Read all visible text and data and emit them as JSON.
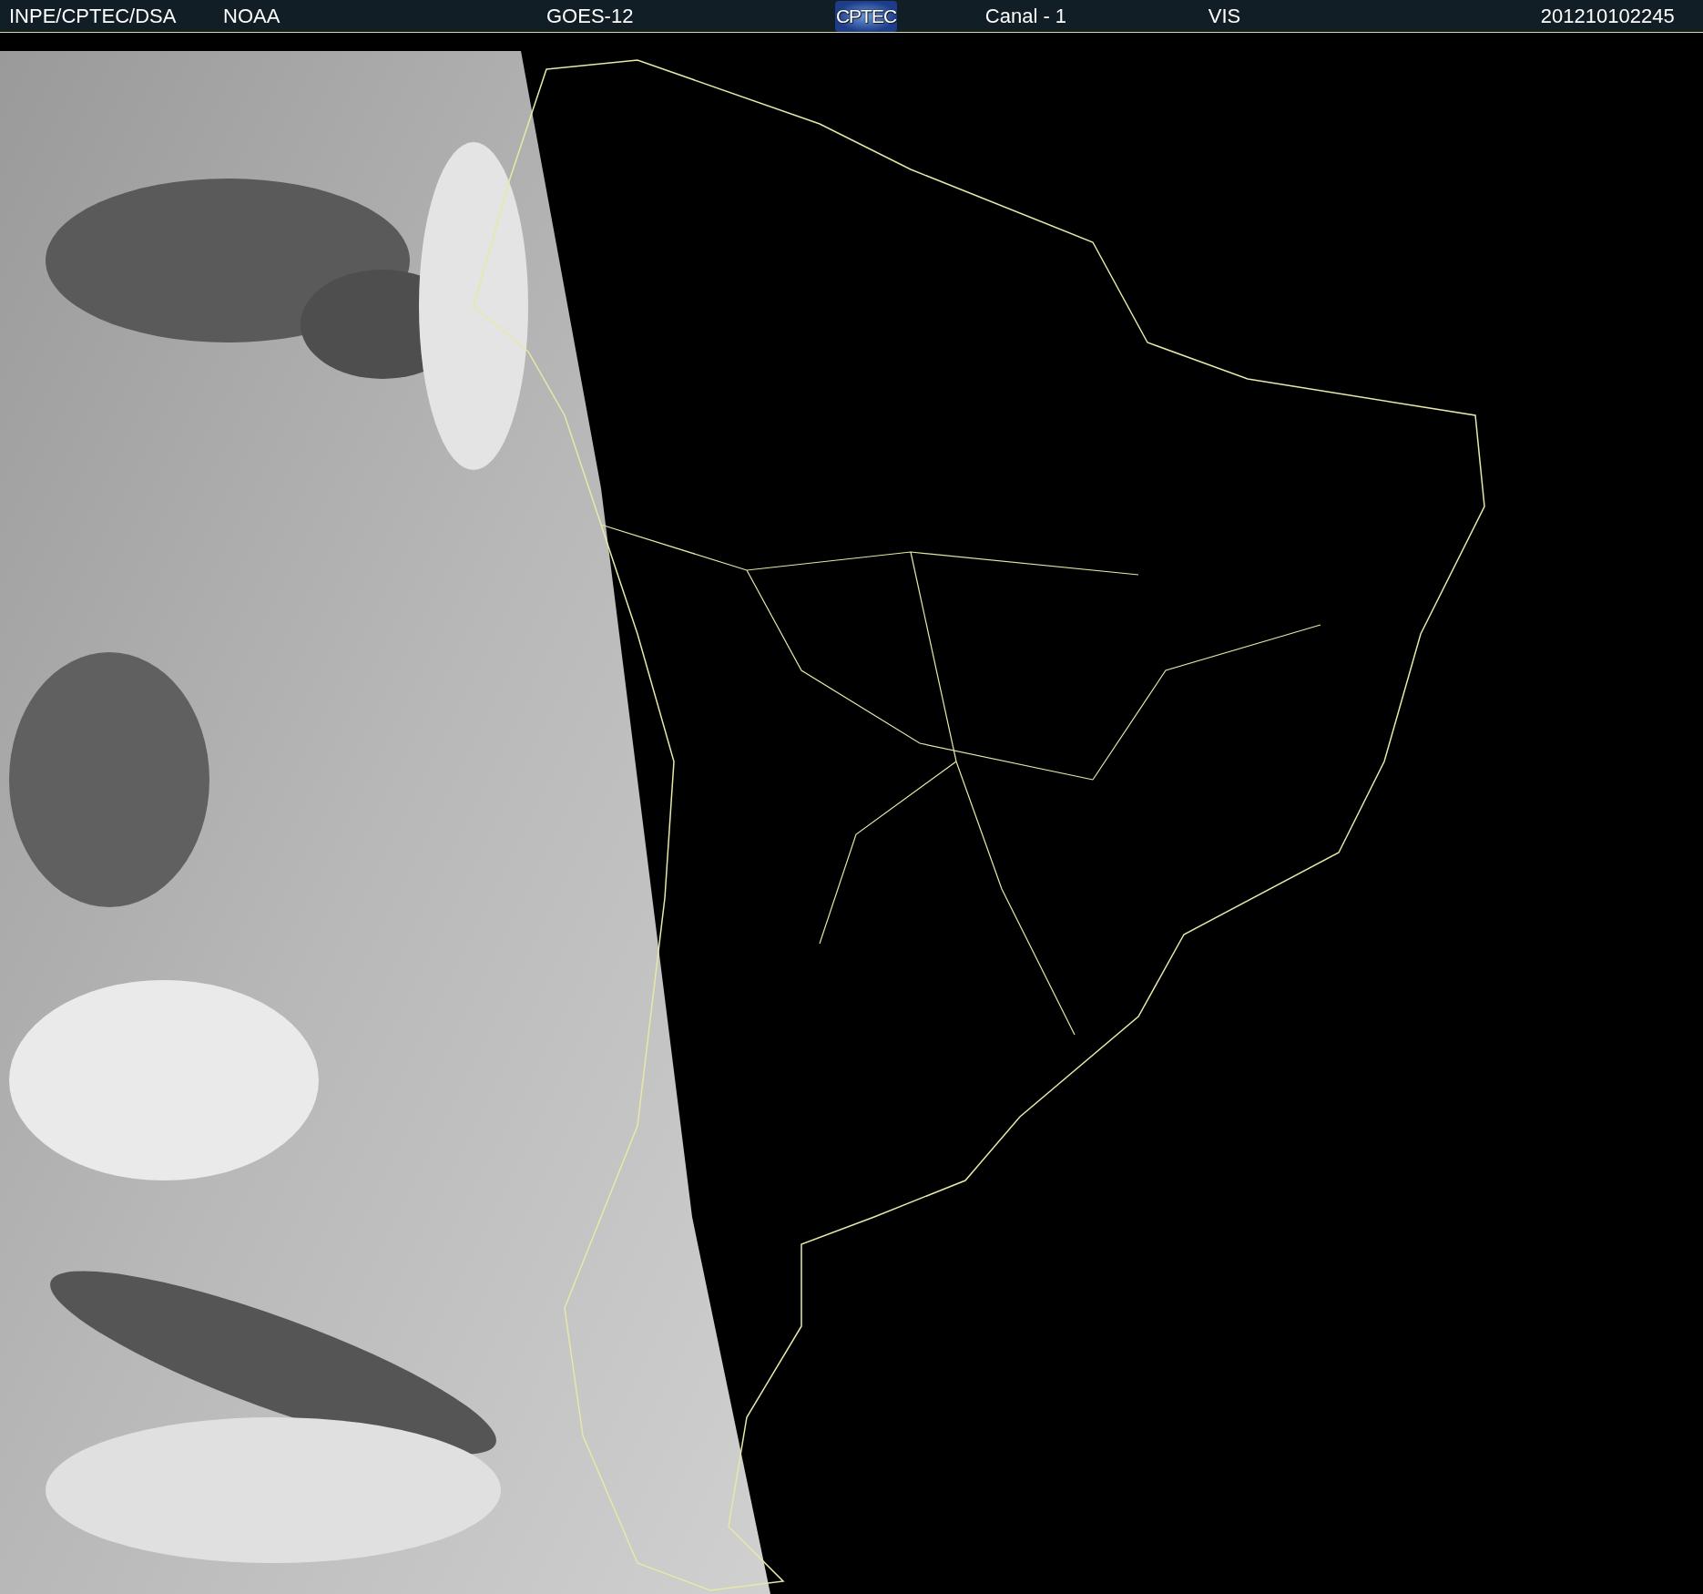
{
  "header": {
    "items": [
      {
        "kind": "text",
        "text": "INPE/CPTEC/DSA"
      },
      {
        "kind": "text",
        "text": "NOAA"
      },
      {
        "kind": "text",
        "text": "GOES-12"
      },
      {
        "kind": "logo",
        "text": "CPTEC"
      },
      {
        "kind": "text",
        "text": "Canal - 1"
      },
      {
        "kind": "text",
        "text": "VIS"
      },
      {
        "kind": "text",
        "text": "201210102245"
      }
    ]
  }
}
